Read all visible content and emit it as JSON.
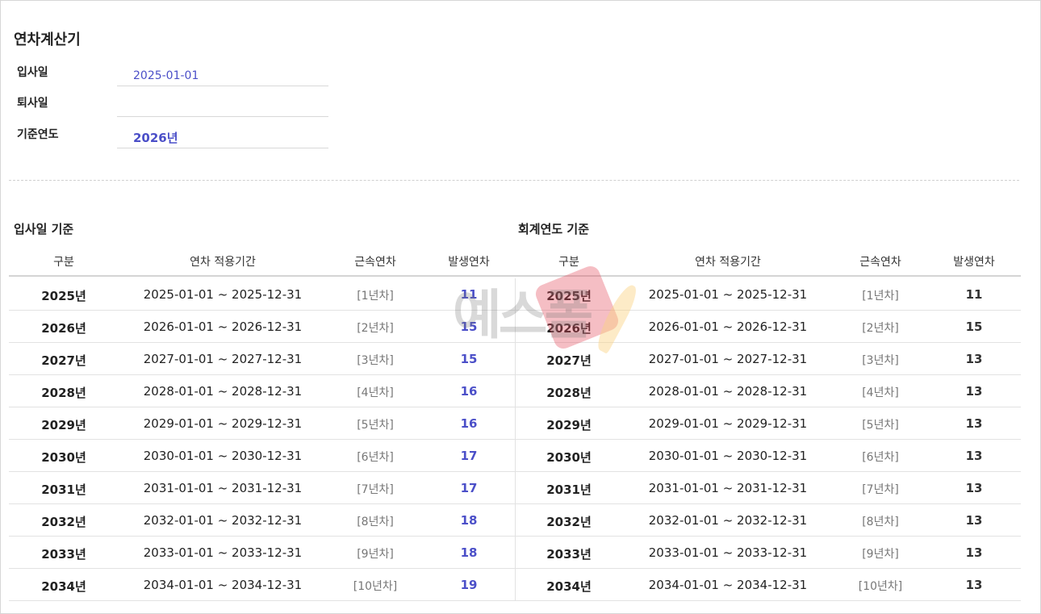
{
  "calculator": {
    "title": "연차계산기",
    "hire_date": {
      "label": "입사일",
      "value": "2025-01-01"
    },
    "leave_date": {
      "label": "퇴사일",
      "value": ""
    },
    "base_year": {
      "label": "기준연도",
      "value": "2026년"
    }
  },
  "sections": {
    "hire_basis_title": "입사일 기준",
    "fiscal_basis_title": "회계연도 기준"
  },
  "table_headers": [
    "구분",
    "연차 적용기간",
    "근속연차",
    "발생연차"
  ],
  "hire_basis_rows": [
    {
      "year": "2025년",
      "period": "2025-01-01 ~ 2025-12-31",
      "tenure": "[1년차]",
      "days": "11"
    },
    {
      "year": "2026년",
      "period": "2026-01-01 ~ 2026-12-31",
      "tenure": "[2년차]",
      "days": "15"
    },
    {
      "year": "2027년",
      "period": "2027-01-01 ~ 2027-12-31",
      "tenure": "[3년차]",
      "days": "15"
    },
    {
      "year": "2028년",
      "period": "2028-01-01 ~ 2028-12-31",
      "tenure": "[4년차]",
      "days": "16"
    },
    {
      "year": "2029년",
      "period": "2029-01-01 ~ 2029-12-31",
      "tenure": "[5년차]",
      "days": "16"
    },
    {
      "year": "2030년",
      "period": "2030-01-01 ~ 2030-12-31",
      "tenure": "[6년차]",
      "days": "17"
    },
    {
      "year": "2031년",
      "period": "2031-01-01 ~ 2031-12-31",
      "tenure": "[7년차]",
      "days": "17"
    },
    {
      "year": "2032년",
      "period": "2032-01-01 ~ 2032-12-31",
      "tenure": "[8년차]",
      "days": "18"
    },
    {
      "year": "2033년",
      "period": "2033-01-01 ~ 2033-12-31",
      "tenure": "[9년차]",
      "days": "18"
    },
    {
      "year": "2034년",
      "period": "2034-01-01 ~ 2034-12-31",
      "tenure": "[10년차]",
      "days": "19"
    }
  ],
  "fiscal_basis_rows": [
    {
      "year": "2025년",
      "period": "2025-01-01 ~ 2025-12-31",
      "tenure": "[1년차]",
      "days": "11"
    },
    {
      "year": "2026년",
      "period": "2026-01-01 ~ 2026-12-31",
      "tenure": "[2년차]",
      "days": "15"
    },
    {
      "year": "2027년",
      "period": "2027-01-01 ~ 2027-12-31",
      "tenure": "[3년차]",
      "days": "13"
    },
    {
      "year": "2028년",
      "period": "2028-01-01 ~ 2028-12-31",
      "tenure": "[4년차]",
      "days": "13"
    },
    {
      "year": "2029년",
      "period": "2029-01-01 ~ 2029-12-31",
      "tenure": "[5년차]",
      "days": "13"
    },
    {
      "year": "2030년",
      "period": "2030-01-01 ~ 2030-12-31",
      "tenure": "[6년차]",
      "days": "13"
    },
    {
      "year": "2031년",
      "period": "2031-01-01 ~ 2031-12-31",
      "tenure": "[7년차]",
      "days": "13"
    },
    {
      "year": "2032년",
      "period": "2032-01-01 ~ 2032-12-31",
      "tenure": "[8년차]",
      "days": "13"
    },
    {
      "year": "2033년",
      "period": "2033-01-01 ~ 2033-12-31",
      "tenure": "[9년차]",
      "days": "13"
    },
    {
      "year": "2034년",
      "period": "2034-01-01 ~ 2034-12-31",
      "tenure": "[10년차]",
      "days": "13"
    }
  ],
  "watermark": {
    "text": "예스폼"
  },
  "colors": {
    "accent": "#4b4fc8",
    "text": "#222222",
    "muted": "#777777"
  }
}
